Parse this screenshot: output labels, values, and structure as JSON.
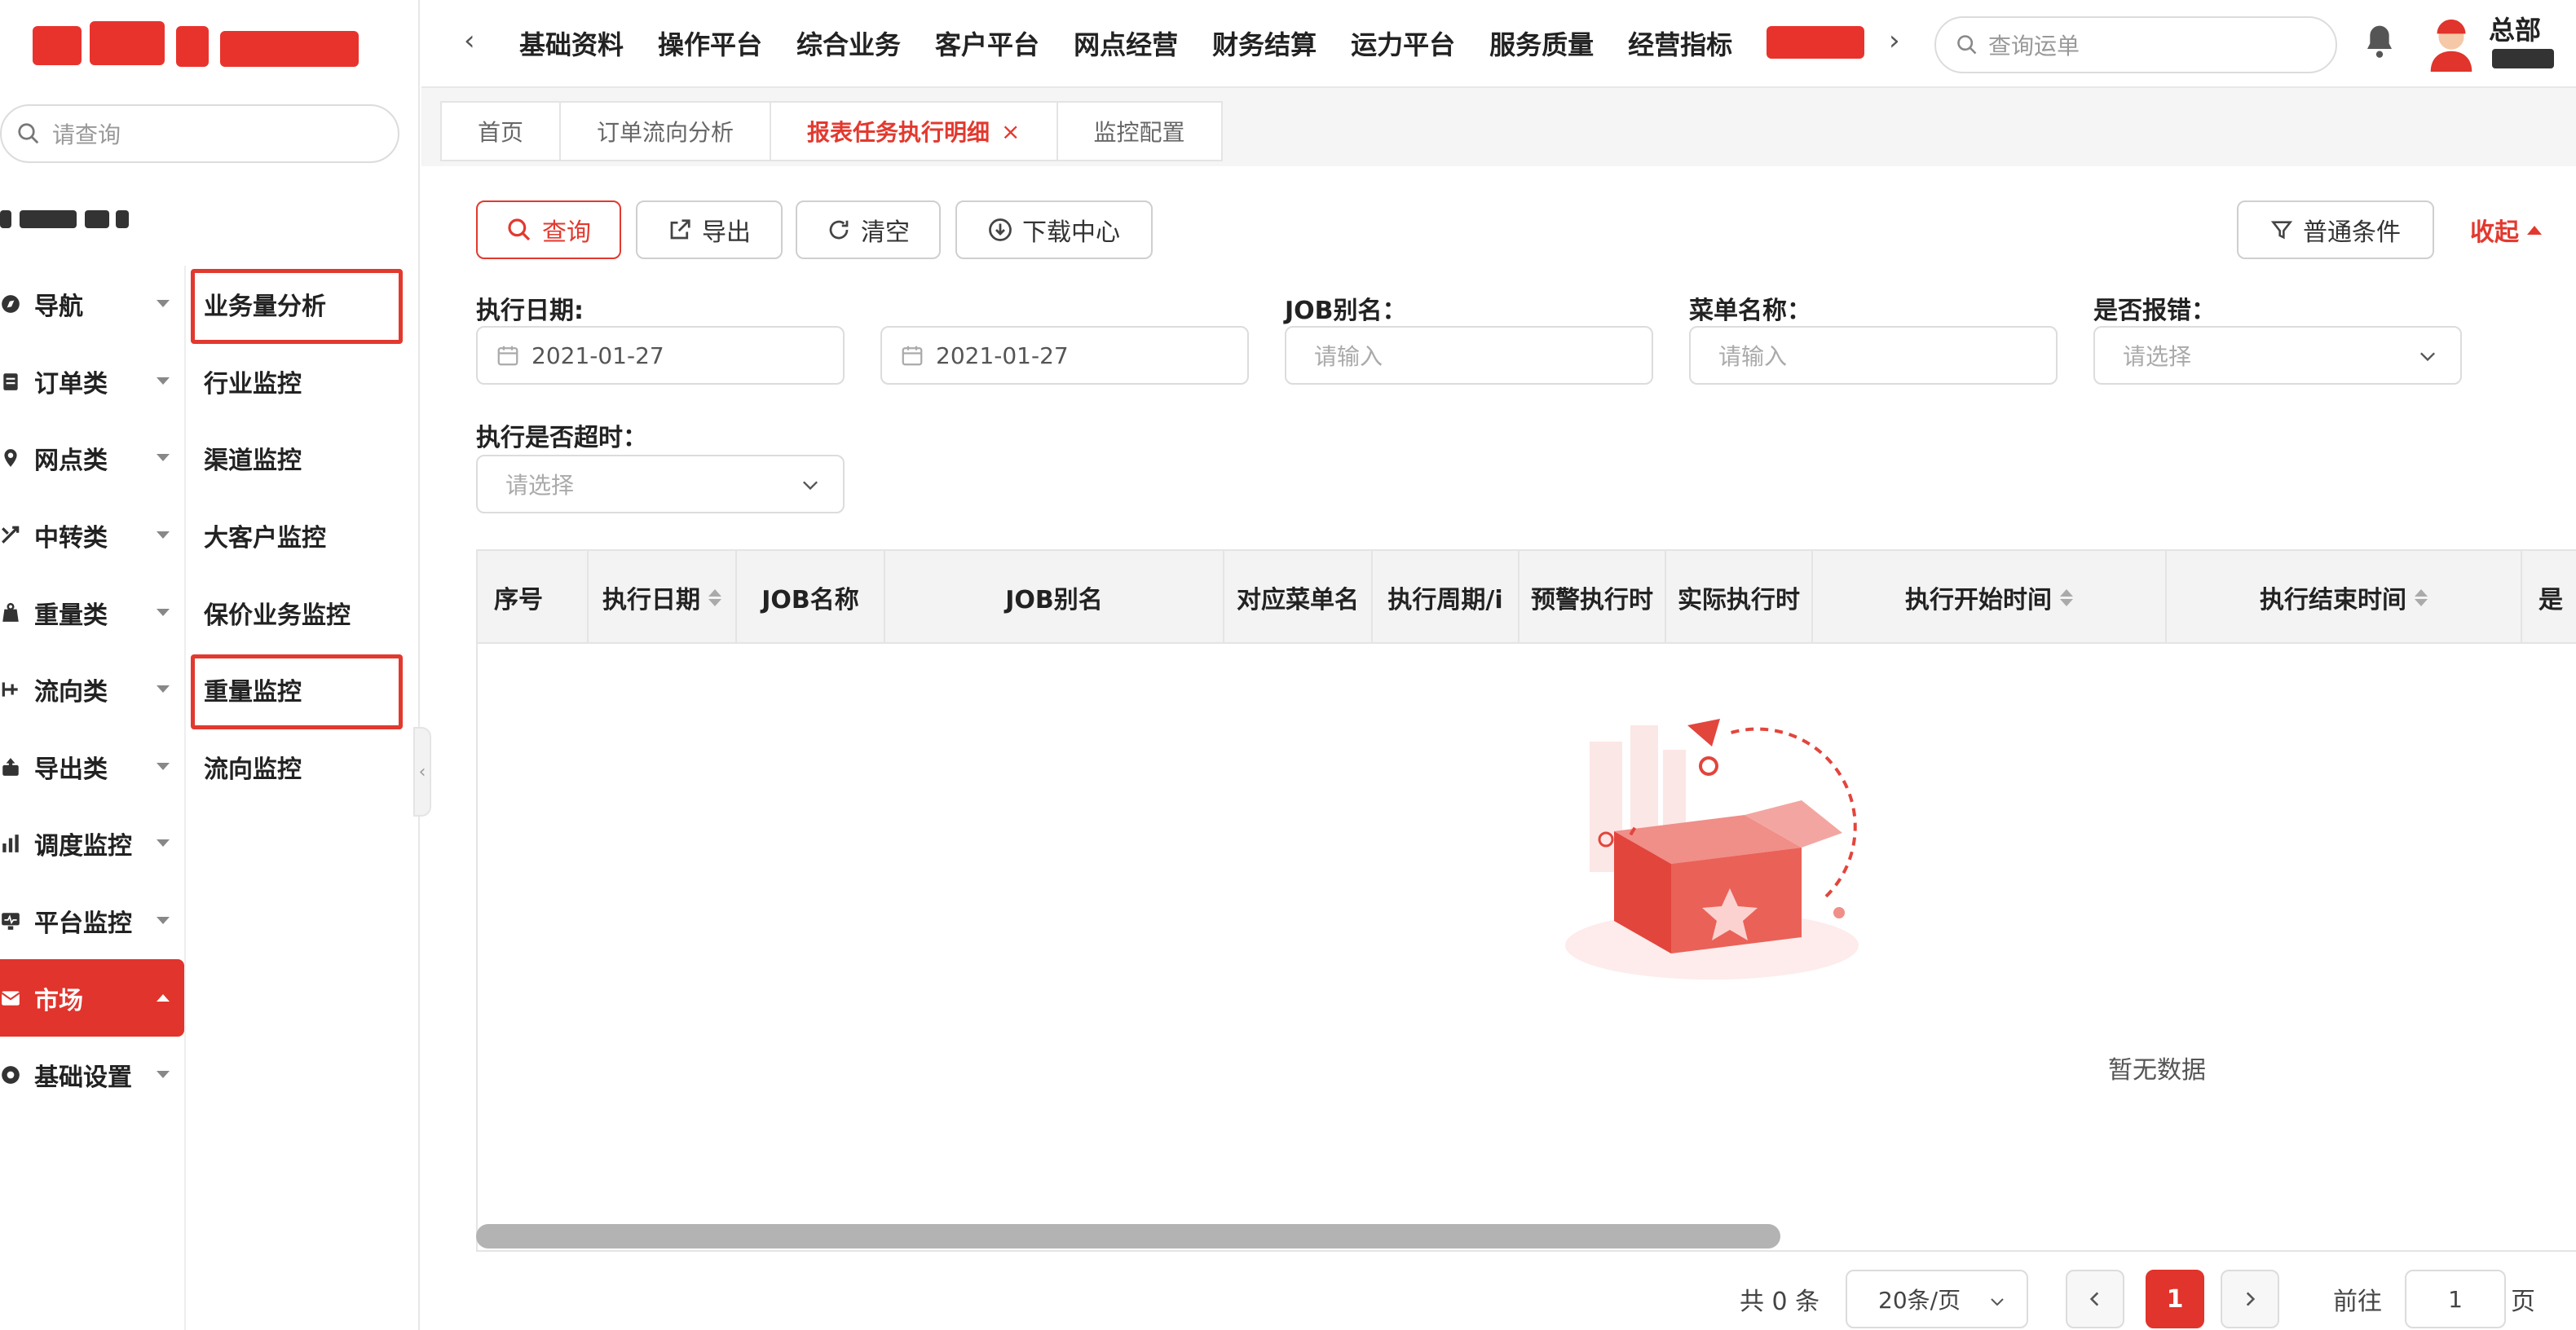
{
  "colors": {
    "accent": "#e0342c",
    "border": "#dcdcdc",
    "header_bg": "#f3f3f3"
  },
  "sidebar": {
    "search_placeholder": "请查询",
    "menu": [
      {
        "label": "导航",
        "icon": "compass-icon"
      },
      {
        "label": "订单类",
        "icon": "clipboard-icon"
      },
      {
        "label": "网点类",
        "icon": "location-icon"
      },
      {
        "label": "中转类",
        "icon": "transfer-icon"
      },
      {
        "label": "重量类",
        "icon": "weight-icon"
      },
      {
        "label": "流向类",
        "icon": "flow-icon"
      },
      {
        "label": "导出类",
        "icon": "export-icon"
      },
      {
        "label": "调度监控",
        "icon": "bar-chart-icon"
      },
      {
        "label": "平台监控",
        "icon": "monitor-icon"
      },
      {
        "label": "市场",
        "icon": "mail-icon",
        "active": true
      },
      {
        "label": "基础设置",
        "icon": "gear-icon"
      }
    ],
    "submenu": [
      {
        "label": "业务量分析",
        "highlighted": true
      },
      {
        "label": "行业监控"
      },
      {
        "label": "渠道监控"
      },
      {
        "label": "大客户监控"
      },
      {
        "label": "保价业务监控"
      },
      {
        "label": "重量监控",
        "highlighted": true
      },
      {
        "label": "流向监控"
      }
    ]
  },
  "topbar": {
    "nav": [
      "基础资料",
      "操作平台",
      "综合业务",
      "客户平台",
      "网点经营",
      "财务结算",
      "运力平台",
      "服务质量",
      "经营指标"
    ],
    "search_placeholder": "查询运单",
    "user_name": "总部"
  },
  "tabs": [
    {
      "label": "首页"
    },
    {
      "label": "订单流向分析"
    },
    {
      "label": "报表任务执行明细",
      "active": true,
      "close": "×"
    },
    {
      "label": "监控配置"
    }
  ],
  "toolbar": {
    "query": "查询",
    "export": "导出",
    "clear": "清空",
    "download": "下载中心",
    "conditions": "普通条件",
    "collapse": "收起"
  },
  "form": {
    "exec_date_label": "执行日期:",
    "date_start": "2021-01-27",
    "date_end": "2021-01-27",
    "job_alias_label": "JOB别名：",
    "job_alias_placeholder": "请输入",
    "menu_name_label": "菜单名称：",
    "menu_name_placeholder": "请输入",
    "is_error_label": "是否报错：",
    "is_error_placeholder": "请选择",
    "is_timeout_label": "执行是否超时：",
    "is_timeout_placeholder": "请选择"
  },
  "table": {
    "columns": [
      "序号",
      "执行日期",
      "JOB名称",
      "JOB别名",
      "对应菜单名",
      "执行周期/i",
      "预警执行时",
      "实际执行时",
      "执行开始时间",
      "执行结束时间",
      "是"
    ],
    "empty_text": "暂无数据"
  },
  "pagination": {
    "total": "共 0 条",
    "page_size": "20条/页",
    "current_page": "1",
    "goto_label": "前往",
    "goto_value": "1",
    "page_unit": "页"
  }
}
